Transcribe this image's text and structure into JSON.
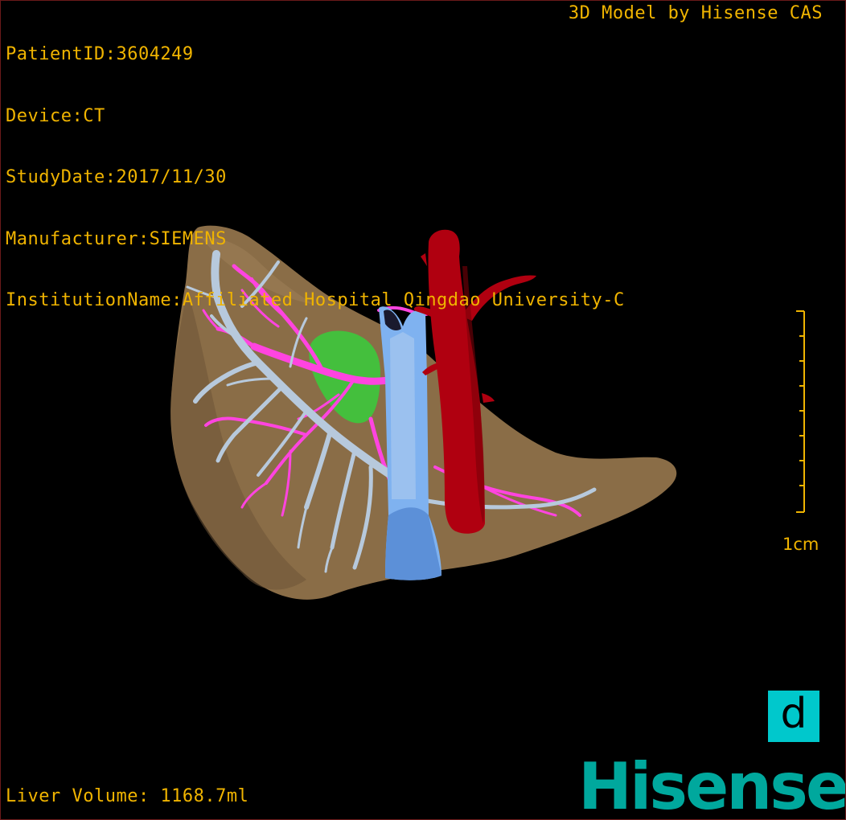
{
  "patient_info": {
    "patient_id": "PatientID:3604249",
    "device": "Device:CT",
    "study_date": "StudyDate:2017/11/30",
    "manufacturer": "Manufacturer:SIEMENS",
    "institution": "InstitutionName:Affiliated Hospital Qingdao University-C"
  },
  "model_credit": "3D Model by Hisense CAS",
  "scale": {
    "label": "1cm"
  },
  "liver_volume": "Liver Volume: 1168.7ml",
  "view_badge": {
    "letter": "d",
    "color": "#00c8cc"
  },
  "brand_logo": {
    "text": "Hisense",
    "color": "#00a89d"
  },
  "colors": {
    "overlay_text": "#f0b400",
    "liver": "#8a6d47",
    "hepatic_vein": "#b7c9dc",
    "portal_vein": "#ff44e0",
    "gallbladder": "#3cc83c",
    "vena_cava": "#7fb2f0",
    "aorta": "#b00010"
  }
}
